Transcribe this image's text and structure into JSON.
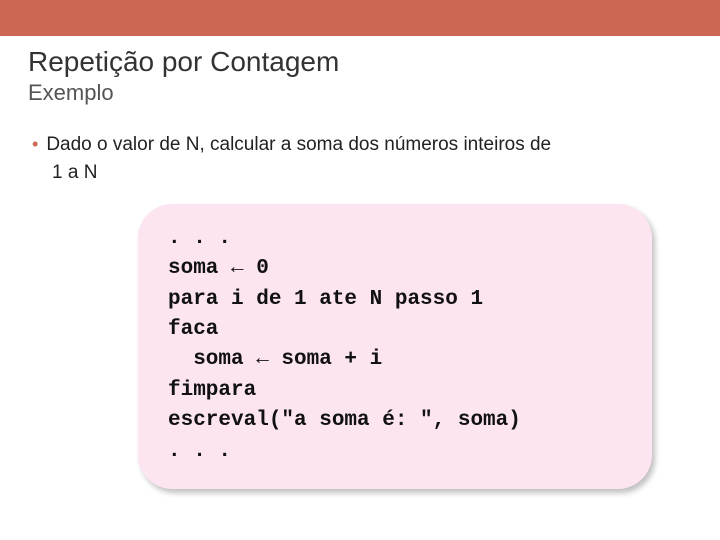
{
  "header": {
    "title": "Repetição por Contagem",
    "subtitle": "Exemplo"
  },
  "bullet": {
    "line1": "Dado o valor de N, calcular a soma dos números inteiros de",
    "line2": "1 a N"
  },
  "code": {
    "l1": ". . .",
    "l2": "soma ← 0",
    "l3": "para i de 1 ate N passo 1",
    "l4": "faca",
    "l5": "  soma ← soma + i",
    "l6": "fimpara",
    "l7": "escreval(\"a soma é: \", soma)",
    "l8": ". . ."
  }
}
